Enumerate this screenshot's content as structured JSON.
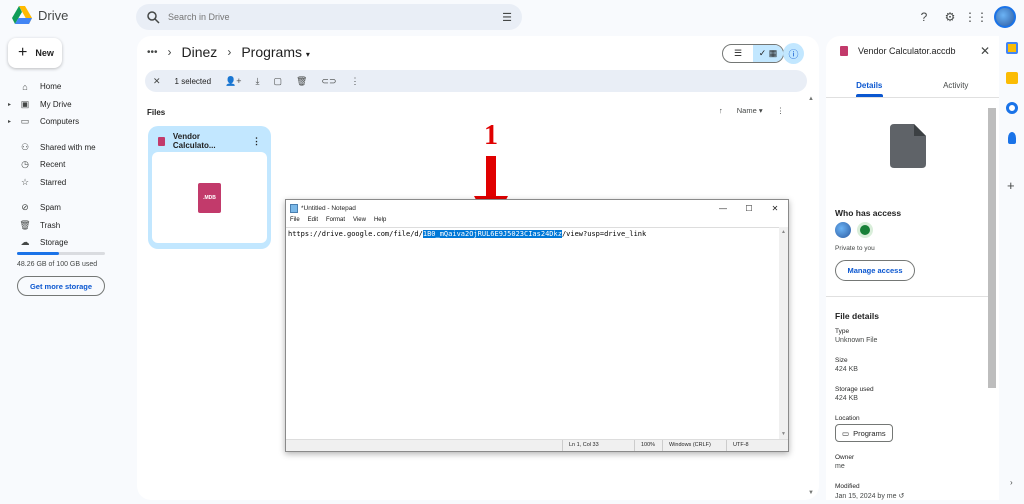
{
  "app": {
    "name": "Drive"
  },
  "search": {
    "placeholder": "Search in Drive"
  },
  "sidebar": {
    "new_label": "New",
    "items": [
      {
        "label": "Home",
        "icon": "home-icon"
      },
      {
        "label": "My Drive",
        "icon": "my-drive-icon"
      },
      {
        "label": "Computers",
        "icon": "computer-icon"
      },
      {
        "label": "Shared with me",
        "icon": "people-icon"
      },
      {
        "label": "Recent",
        "icon": "clock-icon"
      },
      {
        "label": "Starred",
        "icon": "star-icon"
      },
      {
        "label": "Spam",
        "icon": "spam-icon"
      },
      {
        "label": "Trash",
        "icon": "trash-icon"
      },
      {
        "label": "Storage",
        "icon": "cloud-icon"
      }
    ],
    "storage_text": "48.26 GB of 100 GB used",
    "storage_fraction": 0.4826,
    "get_storage_label": "Get more storage"
  },
  "breadcrumb": {
    "more": "•••",
    "parent": "Dinez",
    "current": "Programs"
  },
  "selection_bar": {
    "count_label": "1 selected"
  },
  "files": {
    "section_label": "Files",
    "sort_label": "Name",
    "items": [
      {
        "name": "Vendor Calculato...",
        "type_label": ".MDB"
      }
    ]
  },
  "notepad": {
    "title": "*Untitled - Notepad",
    "menu": [
      "File",
      "Edit",
      "Format",
      "View",
      "Help"
    ],
    "text_before": "https://drive.google.com/file/d/",
    "text_selected": "1B0_mQaiva2OjRUL6E9J5023CIas24Dkz",
    "text_after": "/view?usp=drive_link",
    "status": [
      "Ln 1, Col 33",
      "100%",
      "Windows (CRLF)",
      "UTF-8"
    ]
  },
  "annotation": {
    "number": "1",
    "color": "#e00000"
  },
  "details": {
    "title": "Vendor Calculator.accdb",
    "tabs": [
      "Details",
      "Activity"
    ],
    "who_has_access_title": "Who has access",
    "private_text": "Private to you",
    "manage_access_label": "Manage access",
    "file_details_title": "File details",
    "fields": [
      {
        "label": "Type",
        "value": "Unknown File"
      },
      {
        "label": "Size",
        "value": "424 KB"
      },
      {
        "label": "Storage used",
        "value": "424 KB"
      },
      {
        "label": "Location",
        "value": "Programs"
      },
      {
        "label": "Owner",
        "value": "me"
      },
      {
        "label": "Modified",
        "value": "Jan 15, 2024 by me"
      }
    ]
  },
  "colors": {
    "accent": "#0b57d0",
    "selected_bg": "#c2e7ff",
    "file_pink": "#c23a6b"
  }
}
